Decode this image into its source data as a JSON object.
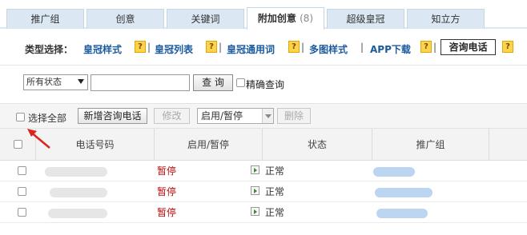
{
  "tabs": [
    {
      "label": "推广组"
    },
    {
      "label": "创意"
    },
    {
      "label": "关键词"
    },
    {
      "label": "附加创意",
      "count": "(8)"
    },
    {
      "label": "超级皇冠"
    },
    {
      "label": "知立方"
    }
  ],
  "type_selection": {
    "label": "类型选择：",
    "options": [
      "皇冠样式",
      "皇冠列表",
      "皇冠通用词",
      "多图样式",
      "APP下载"
    ],
    "help_glyph": "?",
    "separator": "|",
    "active_option": "咨询电话"
  },
  "filter": {
    "status_select": "所有状态",
    "search_value": "",
    "query_button": "查 询",
    "precise_label": "精确查询"
  },
  "toolbar": {
    "select_all": "选择全部",
    "add_button": "新增咨询电话",
    "edit_button": "修改",
    "toggle_select": "启用/暂停",
    "delete_button": "删除"
  },
  "table": {
    "columns": [
      "电话号码",
      "启用/暂停",
      "状态",
      "推广组"
    ],
    "rows": [
      {
        "toggle": "暂停",
        "status": "正常"
      },
      {
        "toggle": "暂停",
        "status": "正常"
      },
      {
        "toggle": "暂停",
        "status": "正常"
      }
    ]
  },
  "colors": {
    "tab_bg": "#dbe7f3",
    "link": "#1a5a9e",
    "paused": "#b80c0c",
    "arrow": "#d9261c"
  }
}
